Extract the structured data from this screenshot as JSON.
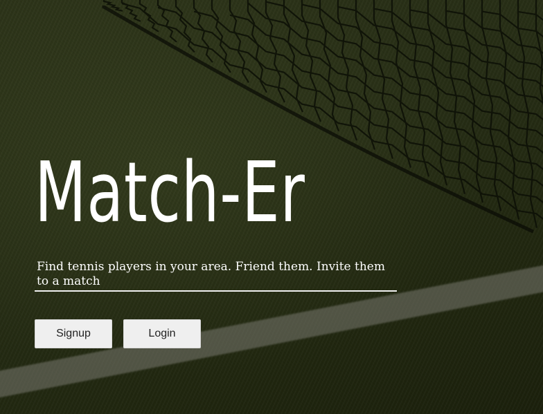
{
  "hero": {
    "title": "Match-Er",
    "tagline": "Find tennis players in your area. Friend them. Invite them to a match"
  },
  "actions": {
    "signup_label": "Signup",
    "login_label": "Login"
  },
  "colors": {
    "title_text": "#ffffff",
    "button_bg": "#efefef",
    "background": "#262d15"
  }
}
